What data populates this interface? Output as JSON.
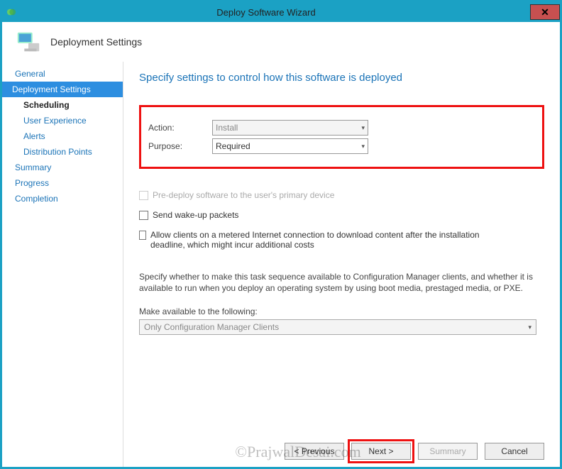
{
  "window": {
    "title": "Deploy Software Wizard",
    "banner": "Deployment Settings"
  },
  "sidebar": {
    "items": [
      {
        "label": "General"
      },
      {
        "label": "Deployment Settings"
      },
      {
        "label": "Scheduling"
      },
      {
        "label": "User Experience"
      },
      {
        "label": "Alerts"
      },
      {
        "label": "Distribution Points"
      },
      {
        "label": "Summary"
      },
      {
        "label": "Progress"
      },
      {
        "label": "Completion"
      }
    ]
  },
  "content": {
    "heading": "Specify settings to control how this software is deployed",
    "action_label": "Action:",
    "action_value": "Install",
    "purpose_label": "Purpose:",
    "purpose_value": "Required",
    "chk_predeploy": "Pre-deploy software to the user's primary device",
    "chk_wakeup": "Send wake-up packets",
    "chk_metered": "Allow clients on a metered Internet connection to download content after the installation deadline, which might incur additional costs",
    "desc": "Specify whether to make this task sequence available to Configuration Manager clients, and whether it is available to run when you deploy an operating system by using boot media, prestaged media, or PXE.",
    "avail_label": "Make available to the following:",
    "avail_value": "Only Configuration Manager Clients"
  },
  "buttons": {
    "previous": "< Previous",
    "next": "Next >",
    "summary": "Summary",
    "cancel": "Cancel"
  },
  "watermark": "©PrajwalDesai.com"
}
